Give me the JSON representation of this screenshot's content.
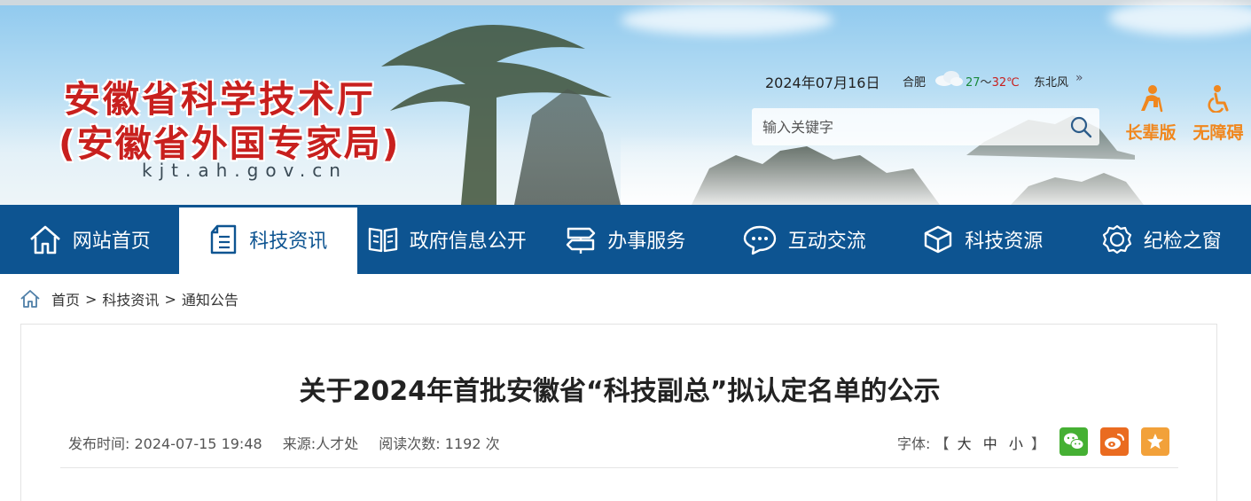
{
  "banner": {
    "title": "安徽省科学技术厅",
    "subtitle": "(安徽省外国专家局)",
    "domain": "kjt.ah.gov.cn",
    "date": "2024年07月16日",
    "weather": {
      "city": "合肥",
      "icon": "cloudy-icon",
      "temp_low": "27",
      "temp_sep": "～",
      "temp_high": "32℃",
      "wind": "东北风",
      "more": "»"
    },
    "search": {
      "placeholder": "输入关键字",
      "icon": "search-icon"
    },
    "elder_mode": {
      "label": "长辈版",
      "icon": "elder-icon"
    },
    "accessibility": {
      "label": "无障碍",
      "icon": "wheelchair-icon"
    }
  },
  "nav": {
    "items": [
      {
        "label": "网站首页",
        "icon": "home-icon"
      },
      {
        "label": "科技资讯",
        "icon": "document-icon",
        "active": true
      },
      {
        "label": "政府信息公开",
        "icon": "book-icon"
      },
      {
        "label": "办事服务",
        "icon": "signpost-icon"
      },
      {
        "label": "互动交流",
        "icon": "chat-icon"
      },
      {
        "label": "科技资源",
        "icon": "cube-icon"
      },
      {
        "label": "纪检之窗",
        "icon": "badge-icon"
      }
    ]
  },
  "breadcrumb": {
    "items": [
      "首页",
      "科技资讯",
      "通知公告"
    ],
    "separator": ">"
  },
  "article": {
    "title": "关于2024年首批安徽省“科技副总”拟认定名单的公示",
    "publish_label": "发布时间:",
    "publish_time": "2024-07-15 19:48",
    "source_label": "来源:",
    "source": "人才处",
    "views_label": "阅读次数:",
    "views": "1192",
    "views_unit": "次",
    "font_label": "字体:",
    "font_open": "【",
    "font_large": "大",
    "font_medium": "中",
    "font_small": "小",
    "font_close": "】",
    "share": [
      "wechat-icon",
      "weibo-icon",
      "favorite-icon"
    ]
  },
  "colors": {
    "nav_bg": "#0d5491",
    "title_red": "#c8201e",
    "accent_orange": "#f0871e"
  }
}
